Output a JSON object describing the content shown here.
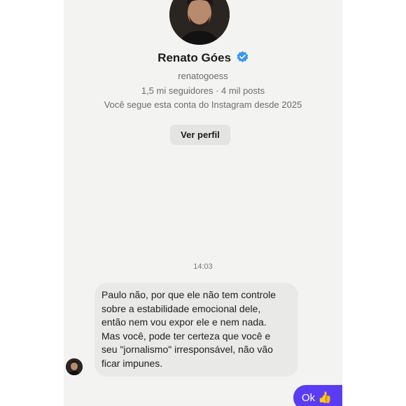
{
  "profile": {
    "name": "Renato Góes",
    "handle": "renatogoess",
    "stats": "1,5 mi seguidores · 4 mil posts",
    "follow_note": "Você segue esta conta do Instagram desde 2025",
    "view_profile_label": "Ver perfil",
    "verified_color": "#3897f0"
  },
  "conversation": {
    "timestamp": "14:03",
    "received_message": {
      "lines": [
        "Paulo não, por que ele não tem controle",
        "sobre a estabilidade emocional dele,",
        "então nem vou expor ele e nem nada.",
        "Mas você, pode ter certeza que você e",
        "seu \"jornalismo\" irresponsável, não vão",
        "ficar impunes."
      ]
    },
    "sent_message": {
      "text": "Ok",
      "emoji": "👍",
      "bubble_color": "#5b3cf5"
    }
  }
}
